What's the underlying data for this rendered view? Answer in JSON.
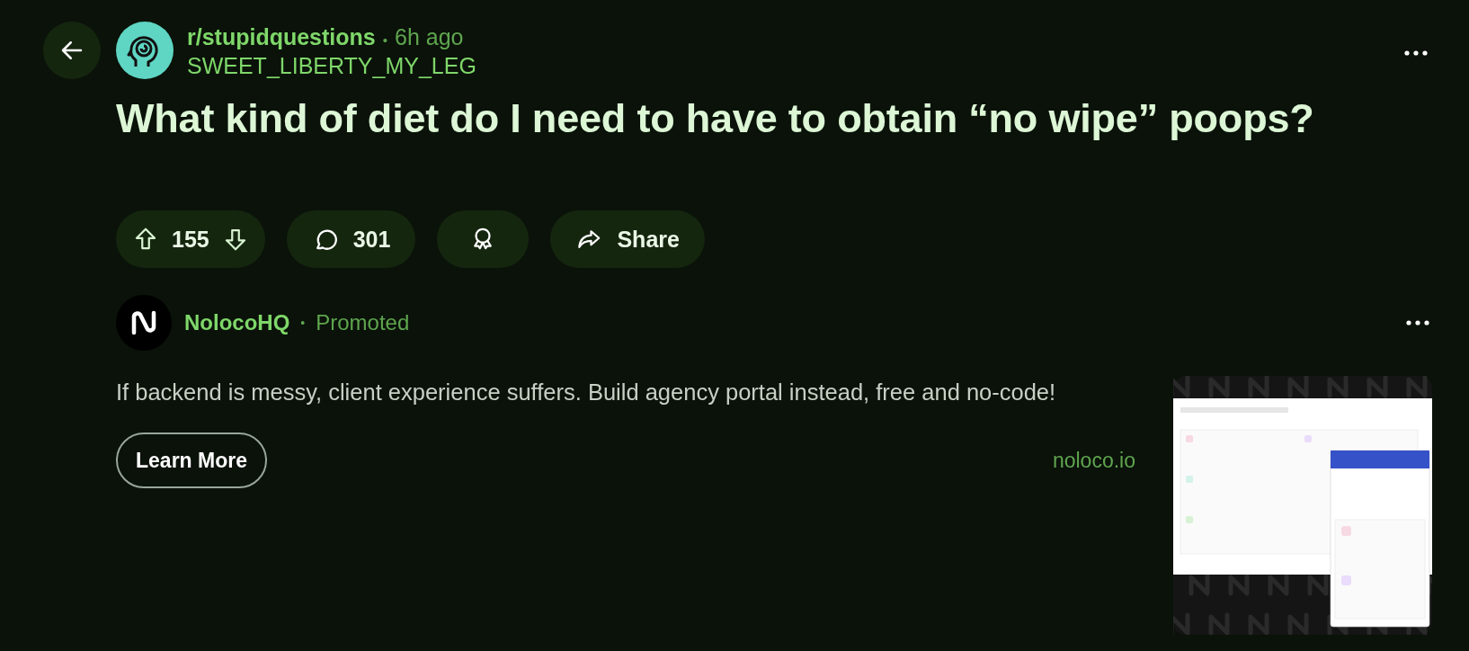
{
  "post": {
    "subreddit": "r/stupidquestions",
    "separator": "•",
    "age": "6h ago",
    "author": "SWEET_LIBERTY_MY_LEG",
    "title": "What kind of diet do I need to have to obtain “no wipe” poops?",
    "votes": "155",
    "comments": "301",
    "share": "Share"
  },
  "ad": {
    "advertiser": "NolocoHQ",
    "separator": "•",
    "label": "Promoted",
    "body": "If backend is messy, client experience suffers. Build agency portal instead, free and no-code!",
    "cta": "Learn More",
    "domain": "noloco.io"
  }
}
